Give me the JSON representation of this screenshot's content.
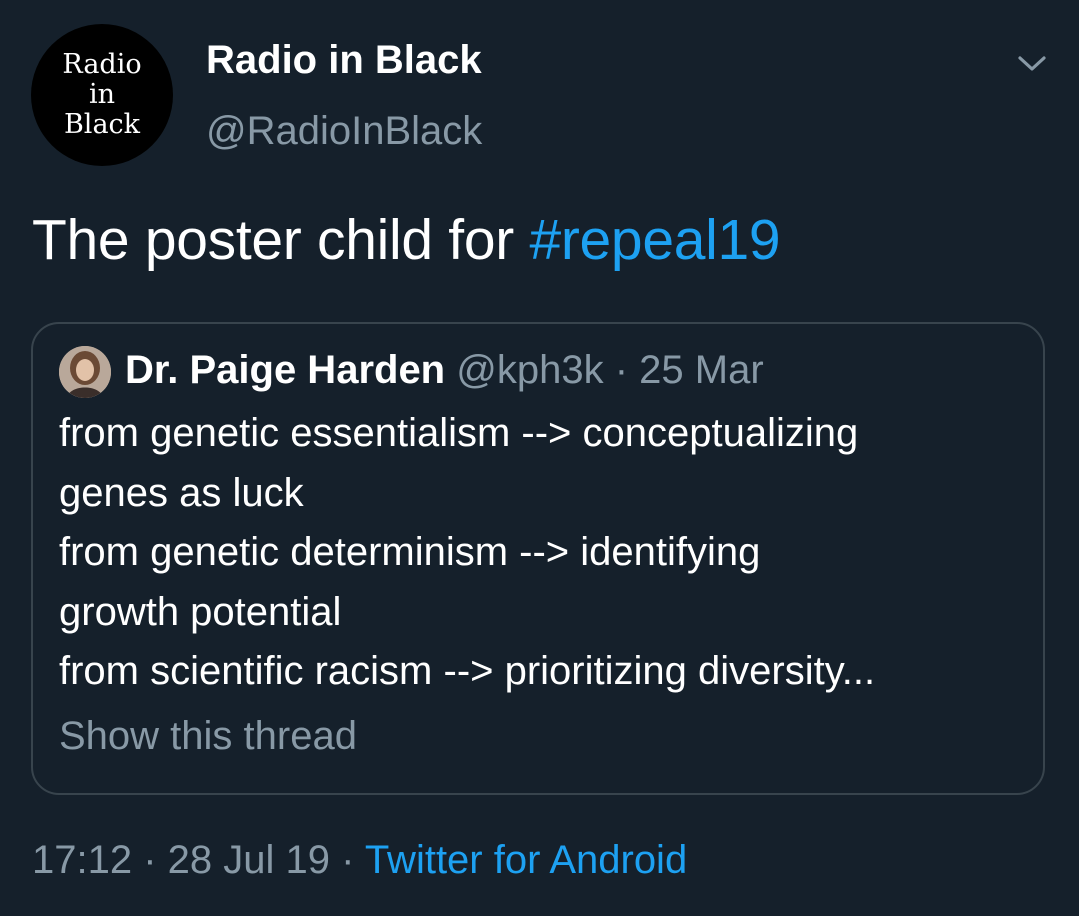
{
  "author": {
    "avatar_text": [
      "Radio",
      "in",
      "Black"
    ],
    "display_name": "Radio in Black",
    "handle": "@RadioInBlack"
  },
  "tweet": {
    "text": "The poster child for ",
    "hashtag": "#repeal19"
  },
  "quoted_tweet": {
    "name": "Dr. Paige Harden",
    "handle": "@kph3k",
    "separator": " · ",
    "date": "25 Mar",
    "lines": [
      "from genetic essentialism --> conceptualizing",
      "genes as luck",
      "from genetic determinism --> identifying",
      "growth potential",
      "from scientific racism --> prioritizing diversity..."
    ],
    "show_thread": "Show this thread"
  },
  "meta": {
    "time": "17:12",
    "separator": " · ",
    "date": "28 Jul 19",
    "source": "Twitter for Android"
  },
  "icons": {
    "menu": "chevron-down-icon"
  },
  "colors": {
    "background": "#15202b",
    "accent": "#1da1f2",
    "secondary_text": "#8899a6",
    "border": "#38444d"
  }
}
